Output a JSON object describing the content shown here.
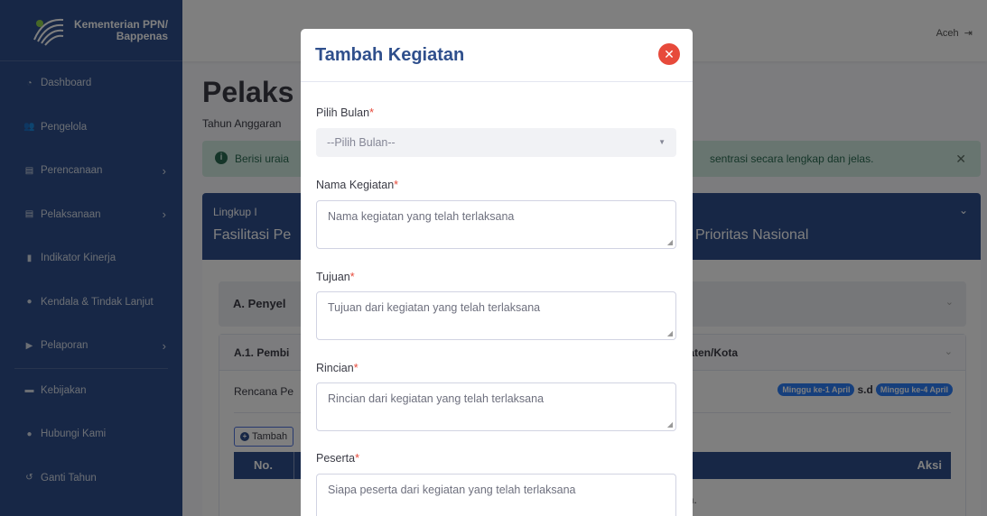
{
  "brand": {
    "line1": "Kementerian PPN/",
    "line2": "Bappenas"
  },
  "sidebar": {
    "items": [
      {
        "label": "Dashboard",
        "icon": "dashboard-icon",
        "chevron": false
      },
      {
        "label": "Pengelola",
        "icon": "users-icon",
        "chevron": false
      },
      {
        "label": "Perencanaan",
        "icon": "file-icon",
        "chevron": true
      },
      {
        "label": "Pelaksanaan",
        "icon": "file-icon",
        "chevron": true
      },
      {
        "label": "Indikator Kinerja",
        "icon": "bar-chart-icon",
        "chevron": false
      },
      {
        "label": "Kendala & Tindak Lanjut",
        "icon": "alert-icon",
        "chevron": false
      },
      {
        "label": "Pelaporan",
        "icon": "report-icon",
        "chevron": true
      },
      {
        "label": "Kebijakan",
        "icon": "folder-icon",
        "chevron": false
      },
      {
        "label": "Hubungi Kami",
        "icon": "chat-icon",
        "chevron": false
      },
      {
        "label": "Ganti Tahun",
        "icon": "history-icon",
        "chevron": false
      }
    ]
  },
  "topbar": {
    "user": "Aceh"
  },
  "main": {
    "title_visible": "Pelaks",
    "subtitle_visible": "Tahun Anggaran",
    "alert_left": "Berisi uraia",
    "alert_right": "sentrasi secara lengkap dan jelas.",
    "panel": {
      "line1": "Lingkup I",
      "line2_left": "Fasilitasi Pe",
      "line2_right": "Prioritas Nasional"
    },
    "accordion_a": "A. Penyel",
    "accordion_a1_left": "A.1. Pembi",
    "accordion_a1_right": "paten/Kota",
    "rencana": "Rencana Pe",
    "badge1": "Minggu ke-1 April",
    "sd": "s.d",
    "badge2": "Minggu ke-4 April",
    "tambah": "Tambah",
    "col_no": "No.",
    "col_aksi": "Aksi",
    "row_fragment": "an."
  },
  "modal": {
    "title": "Tambah Kegiatan",
    "fields": {
      "bulan": {
        "label": "Pilih Bulan",
        "placeholder": "--Pilih Bulan--"
      },
      "nama": {
        "label": "Nama Kegiatan",
        "placeholder": "Nama kegiatan yang telah terlaksana"
      },
      "tujuan": {
        "label": "Tujuan",
        "placeholder": "Tujuan dari kegiatan yang telah terlaksana"
      },
      "rincian": {
        "label": "Rincian",
        "placeholder": "Rincian dari kegiatan yang telah terlaksana"
      },
      "peserta": {
        "label": "Peserta",
        "placeholder": "Siapa peserta dari kegiatan yang telah terlaksana"
      }
    },
    "required_mark": "*"
  },
  "colors": {
    "primary": "#2f4f8c",
    "danger": "#e74a3b",
    "success_bg": "#d1ebe0",
    "badge": "#2d7ff9"
  }
}
